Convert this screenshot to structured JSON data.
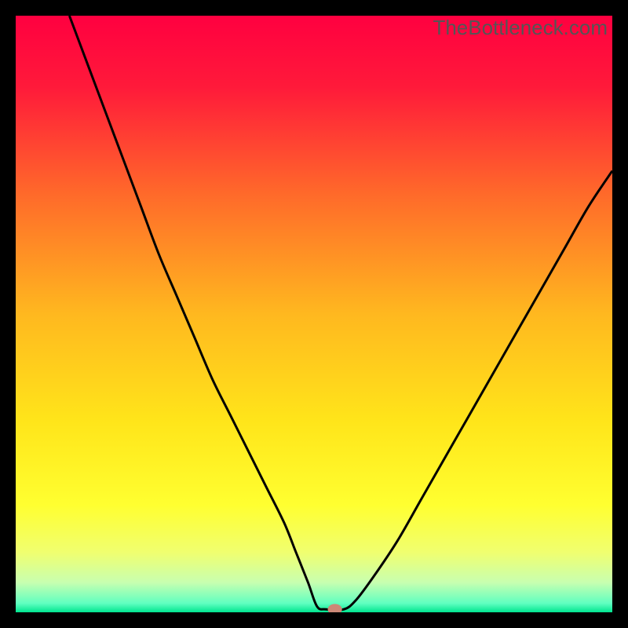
{
  "watermark": "TheBottleneck.com",
  "chart_data": {
    "type": "line",
    "title": "",
    "xlabel": "",
    "ylabel": "",
    "xlim": [
      0,
      100
    ],
    "ylim": [
      0,
      100
    ],
    "grid": false,
    "background_gradient": {
      "type": "vertical",
      "stops": [
        {
          "pos": 0.0,
          "color": "#ff0040"
        },
        {
          "pos": 0.12,
          "color": "#ff1a3a"
        },
        {
          "pos": 0.3,
          "color": "#ff6a2a"
        },
        {
          "pos": 0.5,
          "color": "#ffb81f"
        },
        {
          "pos": 0.68,
          "color": "#ffe51a"
        },
        {
          "pos": 0.82,
          "color": "#ffff30"
        },
        {
          "pos": 0.9,
          "color": "#f0ff70"
        },
        {
          "pos": 0.95,
          "color": "#c8ffb0"
        },
        {
          "pos": 0.985,
          "color": "#60ffc0"
        },
        {
          "pos": 1.0,
          "color": "#00e590"
        }
      ]
    },
    "series": [
      {
        "name": "bottleneck-curve",
        "color": "#000000",
        "x": [
          9,
          12,
          15,
          18,
          21,
          24,
          27,
          30,
          33,
          36,
          39,
          42,
          45,
          47,
          49,
          50.5,
          52,
          55,
          57,
          60,
          64,
          68,
          72,
          76,
          80,
          84,
          88,
          92,
          96,
          100
        ],
        "y": [
          100,
          92,
          84,
          76,
          68,
          60,
          53,
          46,
          39,
          33,
          27,
          21,
          15,
          10,
          5,
          1,
          0.5,
          0.5,
          2,
          6,
          12,
          19,
          26,
          33,
          40,
          47,
          54,
          61,
          68,
          74
        ]
      }
    ],
    "marker": {
      "name": "highlight-dot",
      "x": 53.5,
      "y": 0.5,
      "rx": 1.2,
      "ry": 0.9,
      "color": "#cc8877"
    }
  }
}
